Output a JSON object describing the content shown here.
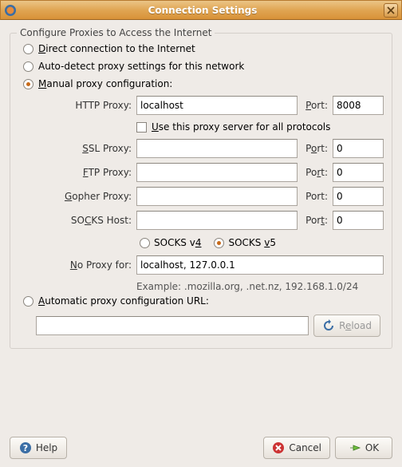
{
  "window": {
    "title": "Connection Settings"
  },
  "fieldset_legend": "Configure Proxies to Access the Internet",
  "radios": {
    "direct": "Direct connection to the Internet",
    "auto_detect": "Auto-detect proxy settings for this network",
    "manual": "Manual proxy configuration:",
    "pac": "Automatic proxy configuration URL:"
  },
  "labels": {
    "http": "HTTP Proxy:",
    "port": "Port:",
    "use_all": "Use this proxy server for all protocols",
    "ssl": "SSL Proxy:",
    "ftp": "FTP Proxy:",
    "gopher": "Gopher Proxy:",
    "socks": "SOCKS Host:",
    "socks_v4": "SOCKS v4",
    "socks_v5": "SOCKS v5",
    "no_proxy": "No Proxy for:",
    "example": "Example: .mozilla.org, .net.nz, 192.168.1.0/24"
  },
  "values": {
    "http_host": "localhost",
    "http_port": "8008",
    "ssl_host": "",
    "ssl_port": "0",
    "ftp_host": "",
    "ftp_port": "0",
    "gopher_host": "",
    "gopher_port": "0",
    "socks_host": "",
    "socks_port": "0",
    "no_proxy": "localhost, 127.0.0.1",
    "pac_url": ""
  },
  "buttons": {
    "reload": "Reload",
    "help": "Help",
    "cancel": "Cancel",
    "ok": "OK"
  }
}
